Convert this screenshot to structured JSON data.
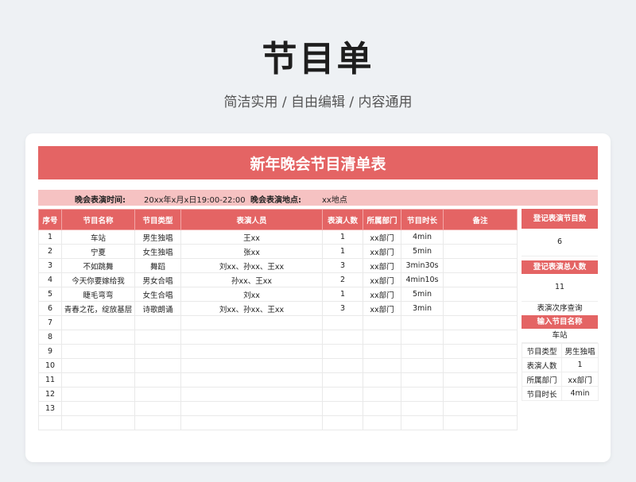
{
  "header": {
    "title": "节目单",
    "subtitle": "简洁实用 / 自由编辑 / 内容通用"
  },
  "sheet": {
    "banner": "新年晚会节目清单表",
    "info": {
      "time_label": "晚会表演时间:",
      "time_value": "20xx年x月x日19:00-22:00",
      "place_label": "晚会表演地点:",
      "place_value": "xx地点"
    },
    "columns": [
      "序号",
      "节目名称",
      "节目类型",
      "表演人员",
      "表演人数",
      "所属部门",
      "节目时长",
      "备注"
    ],
    "rows": [
      [
        "1",
        "车站",
        "男生独唱",
        "王xx",
        "1",
        "xx部门",
        "4min",
        ""
      ],
      [
        "2",
        "宁夏",
        "女生独唱",
        "张xx",
        "1",
        "xx部门",
        "5min",
        ""
      ],
      [
        "3",
        "不如跳舞",
        "舞蹈",
        "刘xx、孙xx、王xx",
        "3",
        "xx部门",
        "3min30s",
        ""
      ],
      [
        "4",
        "今天你要嫁给我",
        "男女合唱",
        "孙xx、王xx",
        "2",
        "xx部门",
        "4min10s",
        ""
      ],
      [
        "5",
        "睫毛弯弯",
        "女生合唱",
        "刘xx",
        "1",
        "xx部门",
        "5min",
        ""
      ],
      [
        "6",
        "青春之花，绽放基层",
        "诗歌朗诵",
        "刘xx、孙xx、王xx",
        "3",
        "xx部门",
        "3min",
        ""
      ],
      [
        "7",
        "",
        "",
        "",
        "",
        "",
        "",
        ""
      ],
      [
        "8",
        "",
        "",
        "",
        "",
        "",
        "",
        ""
      ],
      [
        "9",
        "",
        "",
        "",
        "",
        "",
        "",
        ""
      ],
      [
        "10",
        "",
        "",
        "",
        "",
        "",
        "",
        ""
      ],
      [
        "11",
        "",
        "",
        "",
        "",
        "",
        "",
        ""
      ],
      [
        "12",
        "",
        "",
        "",
        "",
        "",
        "",
        ""
      ],
      [
        "13",
        "",
        "",
        "",
        "",
        "",
        "",
        ""
      ],
      [
        "",
        "",
        "",
        "",
        "",
        "",
        "",
        ""
      ]
    ]
  },
  "side": {
    "count_label": "登记表演节目数",
    "count_value": "6",
    "people_label": "登记表演总人数",
    "people_value": "11",
    "query_title": "表演次序查询",
    "input_label": "输入节目名称",
    "input_value": "车站",
    "fields": [
      [
        "节目类型",
        "男生独唱"
      ],
      [
        "表演人数",
        "1"
      ],
      [
        "所属部门",
        "xx部门"
      ],
      [
        "节目时长",
        "4min"
      ]
    ]
  },
  "colors": {
    "accent": "#e46464",
    "accent_light": "#f6c2c2",
    "background": "#eef1f4"
  }
}
